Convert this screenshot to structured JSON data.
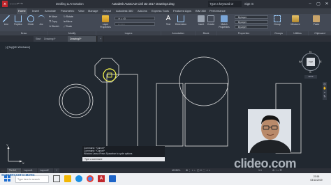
{
  "app": {
    "title": "Autodesk AutoCAD Civil 3D 2017   Drawing4.dwg",
    "workspace": "Drafting & Annotation",
    "search_placeholder": "Type a keyword or phrase",
    "sign_in": "Sign In"
  },
  "ribbon_tabs": [
    "Home",
    "Insert",
    "Annotate",
    "Parametric",
    "View",
    "Manage",
    "Output",
    "Autodesk 360",
    "Add-ins",
    "Express Tools",
    "Featured Apps",
    "BIM 360",
    "Performance"
  ],
  "ribbon": {
    "draw_tools": [
      "Line",
      "Polyline",
      "Circle",
      "Arc"
    ],
    "modify_tools": [
      "Move",
      "Copy",
      "Stretch",
      "Rotate",
      "Mirror",
      "Scale"
    ],
    "layer_tool": "Layer Properties",
    "annotation_tools": [
      "Text",
      "Dimension"
    ],
    "block_tools": [
      "Insert",
      "Create"
    ],
    "properties_tools": [
      "Match Properties"
    ],
    "groups_tool": "Group",
    "utilities_tool": "Measure",
    "clipboard_tool": "Paste",
    "bylayer_values": [
      "ByLayer",
      "ByLayer",
      "ByLayer"
    ],
    "panels": [
      "Draw",
      "Modify",
      "Layers",
      "Annotation",
      "Block",
      "Properties",
      "Groups",
      "Utilities",
      "Clipboard"
    ]
  },
  "doc_tabs": [
    "Start",
    "Drawing4*",
    "Drawing5*"
  ],
  "view_label": "[-][Top][2D Wireframe]",
  "compass": {
    "north": "N",
    "south": "S",
    "east": "E",
    "west": "W",
    "top": "TOP",
    "wcs": "WCS"
  },
  "command": {
    "history": [
      "Command: *Cancel*",
      "Command: *Cancel*",
      "Window Lasso  Press Spacebar to cycle options"
    ],
    "prompt": "Type a command"
  },
  "layout_tabs": [
    "Model",
    "Layout1",
    "Layout2"
  ],
  "status": {
    "mode": "MODEL",
    "scale": "1:1"
  },
  "taskbar": {
    "search_placeholder": "Type here to search",
    "time": "23:55",
    "date": "03/11/2019"
  },
  "recorder": {
    "line1": "RECORDED WITH",
    "line2": "SCREENCAST-O-MATIC"
  },
  "watermark": "clideo.com",
  "colors": {
    "canvas": "#212830",
    "ribbon": "#434955",
    "selection": "#ffff4d",
    "geometry": "#e6e6e6"
  }
}
